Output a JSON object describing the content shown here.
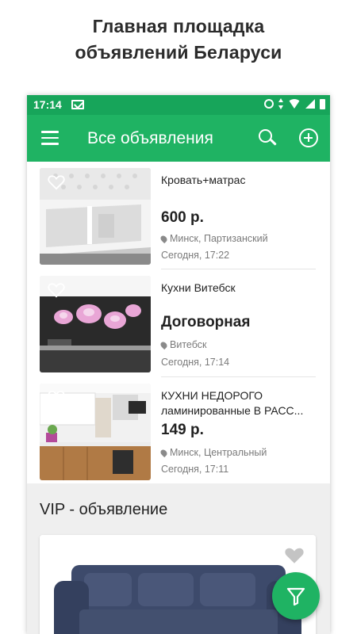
{
  "promo": {
    "line1": "Главная площадка",
    "line2": "объявлений Беларуси"
  },
  "status_bar": {
    "time": "17:14"
  },
  "app_bar": {
    "title": "Все объявления",
    "menu_icon": "menu-icon",
    "search_icon": "search-icon",
    "add_icon": "add-circle-icon"
  },
  "listings": [
    {
      "title": "Кровать+матрас",
      "price": "600 р.",
      "location": "Минск, Партизанский",
      "date": "Сегодня, 17:22",
      "image": "bed-photo"
    },
    {
      "title": "Кухни Витебск",
      "price": "Договорная",
      "location": "Витебск",
      "date": "Сегодня, 17:14",
      "image": "kitchen-orchid-photo"
    },
    {
      "title": "КУХНИ НЕДОРОГО ламинированные В РАСС...",
      "price": "149 р.",
      "location": "Минск, Центральный",
      "date": "Сегодня, 17:11",
      "image": "kitchen-wood-photo"
    }
  ],
  "vip": {
    "heading": "VIP - объявление",
    "image": "sofa-photo"
  },
  "fab": {
    "icon": "filter-icon"
  },
  "colors": {
    "status_bar": "#17a55a",
    "app_bar": "#1fb363",
    "fab": "#1fb363"
  }
}
